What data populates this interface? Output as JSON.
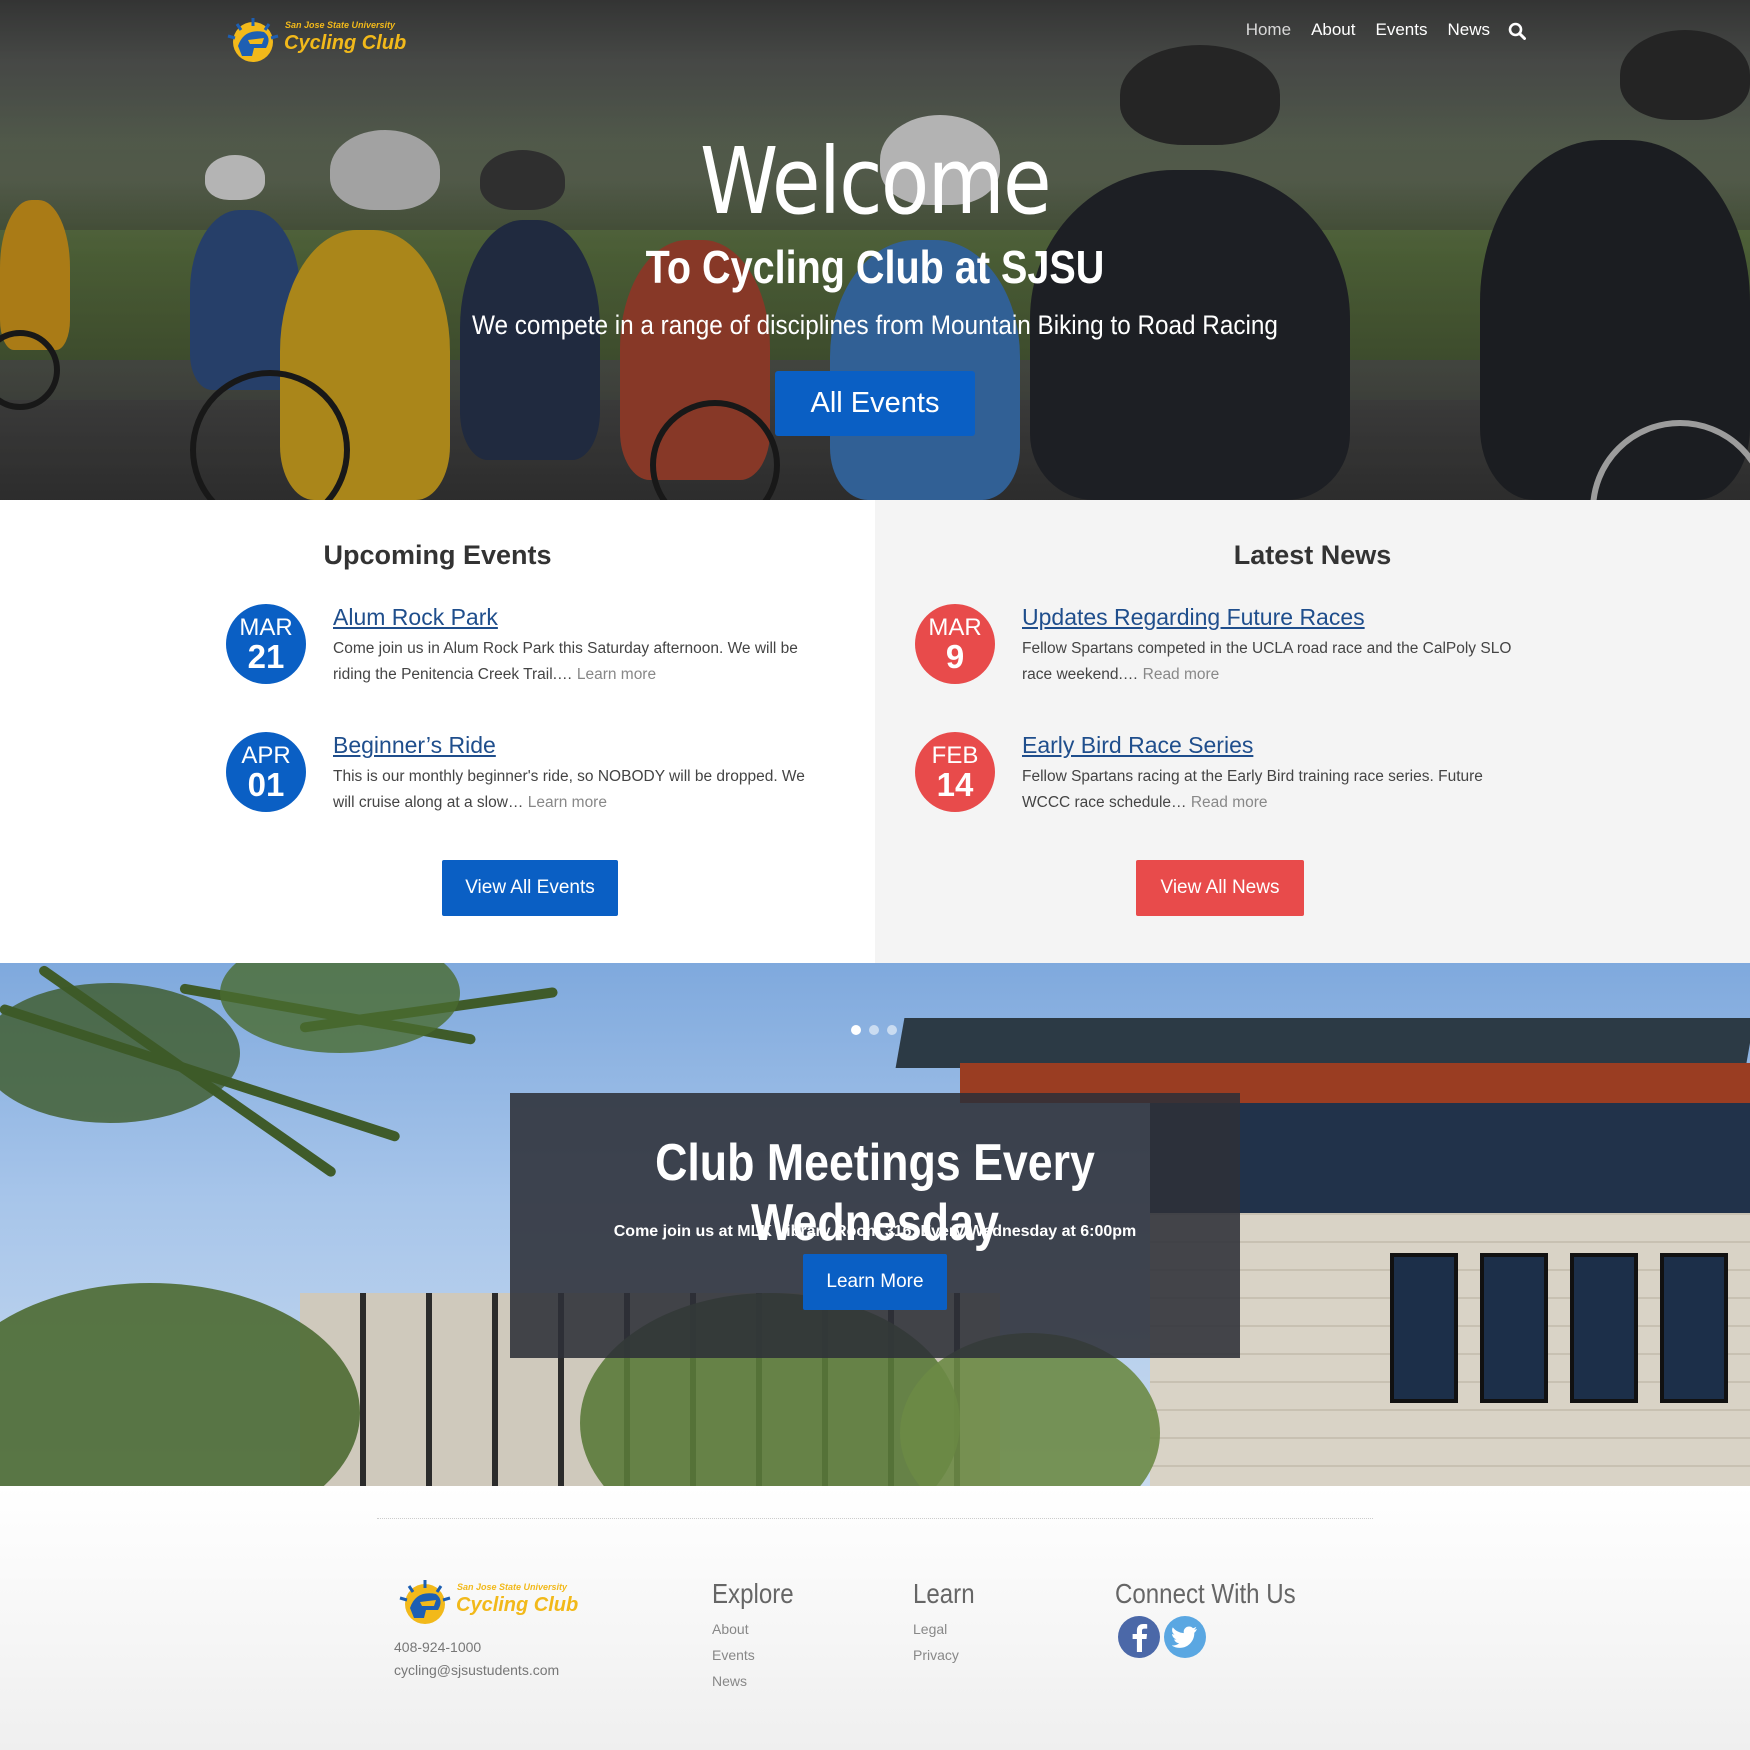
{
  "brand": {
    "university": "San Jose State University",
    "name": "Cycling Club"
  },
  "nav": {
    "items": [
      {
        "label": "Home",
        "active": true
      },
      {
        "label": "About"
      },
      {
        "label": "Events"
      },
      {
        "label": "News"
      }
    ],
    "search_icon": "search-icon"
  },
  "hero": {
    "title": "Welcome",
    "subtitle": "To Cycling Club at SJSU",
    "description": "We compete in a range of disciplines from Mountain Biking to Road Racing",
    "button": "All Events"
  },
  "events": {
    "title": "Upcoming Events",
    "items": [
      {
        "month": "MAR",
        "day": "21",
        "title": "Alum Rock Park",
        "body": "Come join us in Alum Rock Park this Saturday afternoon. We will be riding the Penitencia Creek Trail.…",
        "more": "Learn more"
      },
      {
        "month": "APR",
        "day": "01",
        "title": "Beginner’s Ride",
        "body": "This is our monthly beginner's ride, so NOBODY will be dropped. We will cruise along at a slow…",
        "more": "Learn more"
      }
    ],
    "button": "View All Events"
  },
  "news": {
    "title": "Latest News",
    "items": [
      {
        "month": "MAR",
        "day": "9",
        "title": "Updates Regarding Future Races",
        "body": "Fellow Spartans competed in the UCLA road race and the CalPoly SLO race weekend.…",
        "more": "Read more"
      },
      {
        "month": "FEB",
        "day": "14",
        "title": "Early Bird Race Series",
        "body": "Fellow Spartans racing at the Early Bird training race series. Future WCCC race schedule…",
        "more": "Read more"
      }
    ],
    "button": "View All News"
  },
  "slider": {
    "slide_count": 3,
    "active_slide": 1,
    "title": "Club Meetings Every Wednesday",
    "text": "Come join us at MLK Library Room 316, Every Wednesday at 6:00pm",
    "button": "Learn More"
  },
  "footer": {
    "phone": "408-924-1000",
    "email": "cycling@sjsustudents.com",
    "explore": {
      "title": "Explore",
      "links": [
        "About",
        "Events",
        "News"
      ]
    },
    "learn": {
      "title": "Learn",
      "links": [
        "Legal",
        "Privacy"
      ]
    },
    "connect": {
      "title": "Connect With Us",
      "icons": [
        "facebook-icon",
        "twitter-icon"
      ]
    }
  },
  "colors": {
    "primary": "#0a5fc4",
    "accent": "#e84b4b",
    "brand_gold": "#f2b91a"
  }
}
